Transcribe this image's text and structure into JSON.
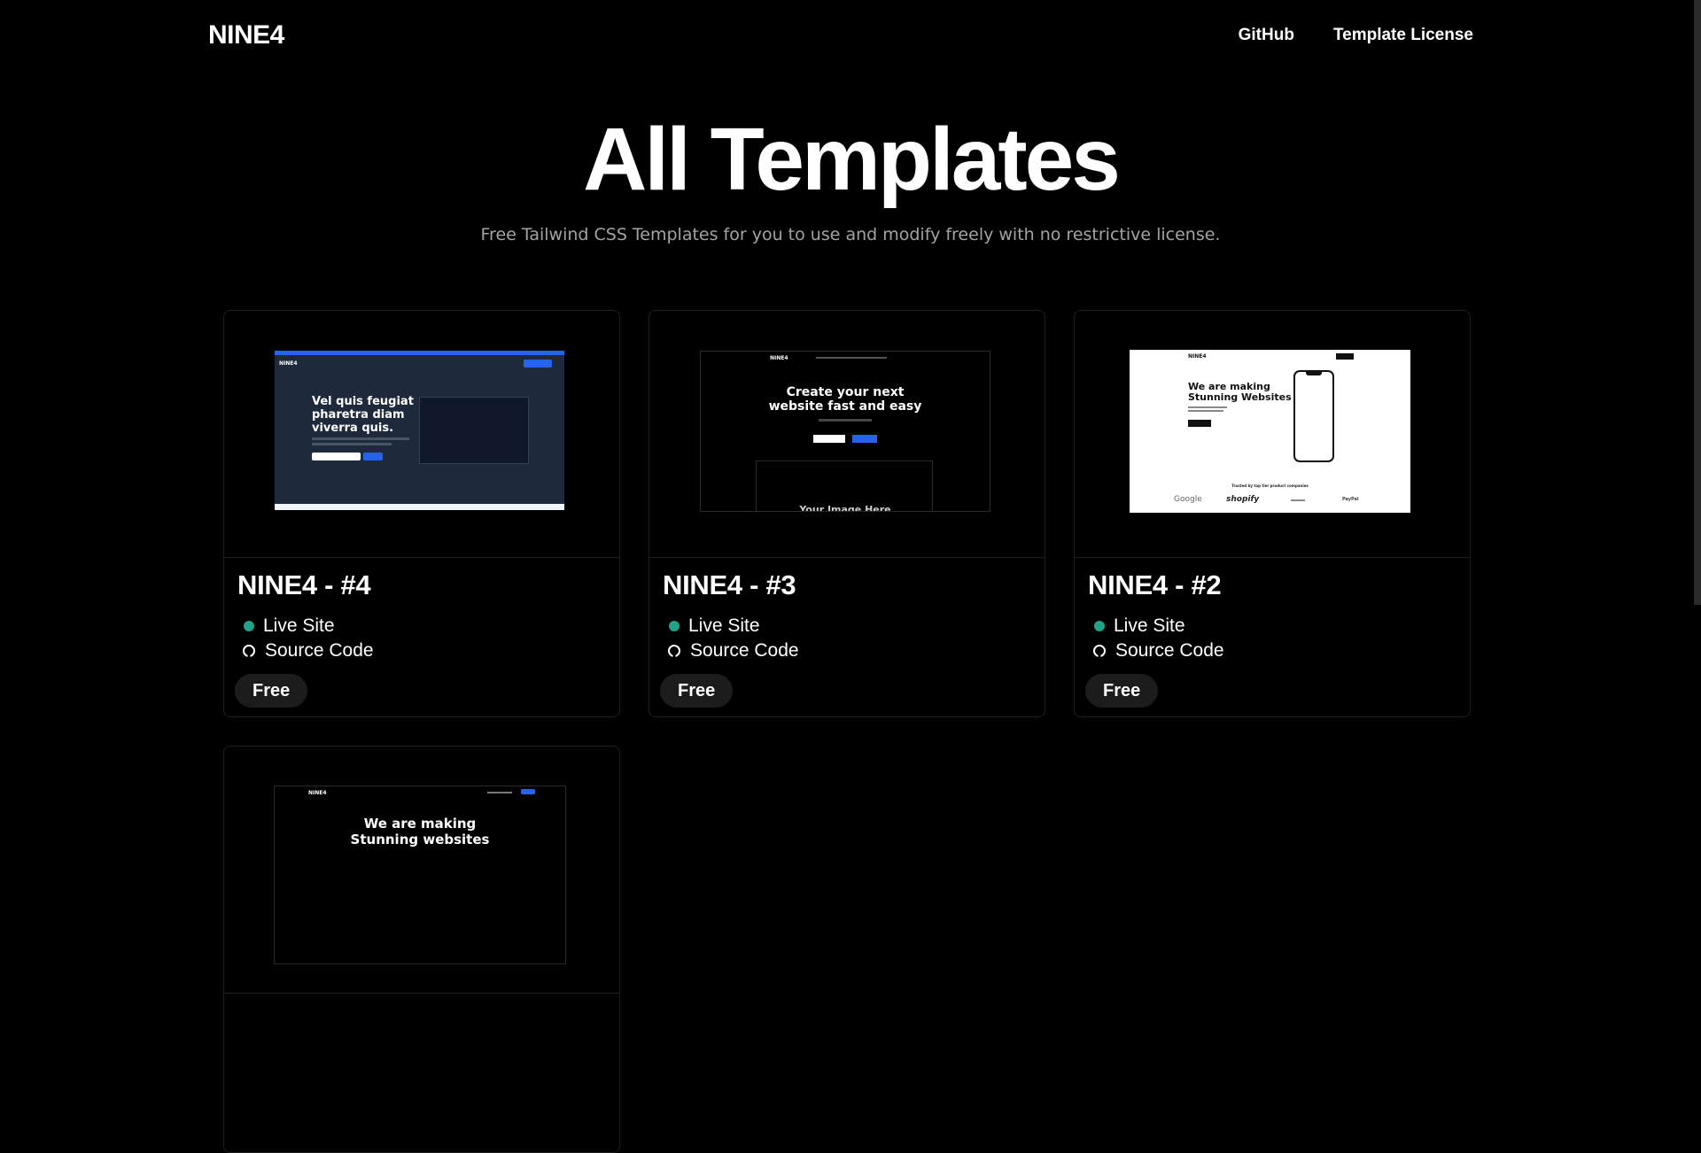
{
  "nav": {
    "logo": "NINE4",
    "links": [
      "GitHub",
      "Template License"
    ]
  },
  "hero": {
    "title": "All Templates",
    "subtitle": "Free Tailwind CSS Templates for you to use and modify freely with no restrictive license."
  },
  "cards": [
    {
      "title": "NINE4 - #4",
      "live_label": "Live Site",
      "source_label": "Source Code",
      "badge": "Free",
      "preview": {
        "headline": [
          "Vel quis feugiat",
          "pharetra diam",
          "viverra quis."
        ],
        "brand": "NINE4"
      }
    },
    {
      "title": "NINE4 - #3",
      "live_label": "Live Site",
      "source_label": "Source Code",
      "badge": "Free",
      "preview": {
        "headline": [
          "Create your next",
          "website fast and easy"
        ],
        "footer_text": "Your Image Here",
        "brand": "NINE4"
      }
    },
    {
      "title": "NINE4 - #2",
      "live_label": "Live Site",
      "source_label": "Source Code",
      "badge": "Free",
      "preview": {
        "headline": [
          "We are making",
          "Stunning Websites"
        ],
        "trusted": "Trusted by top tier product companies",
        "logos": [
          "Google",
          "shopify",
          "",
          "PayPal"
        ],
        "brand": "NINE4"
      }
    },
    {
      "preview": {
        "headline": [
          "We are making",
          "Stunning websites"
        ],
        "brand": "NINE4"
      }
    }
  ],
  "colors": {
    "background": "#000000",
    "accent_dot": "#21a38b",
    "badge_bg": "#1c1c1c",
    "subtitle": "#a3a3a3"
  }
}
